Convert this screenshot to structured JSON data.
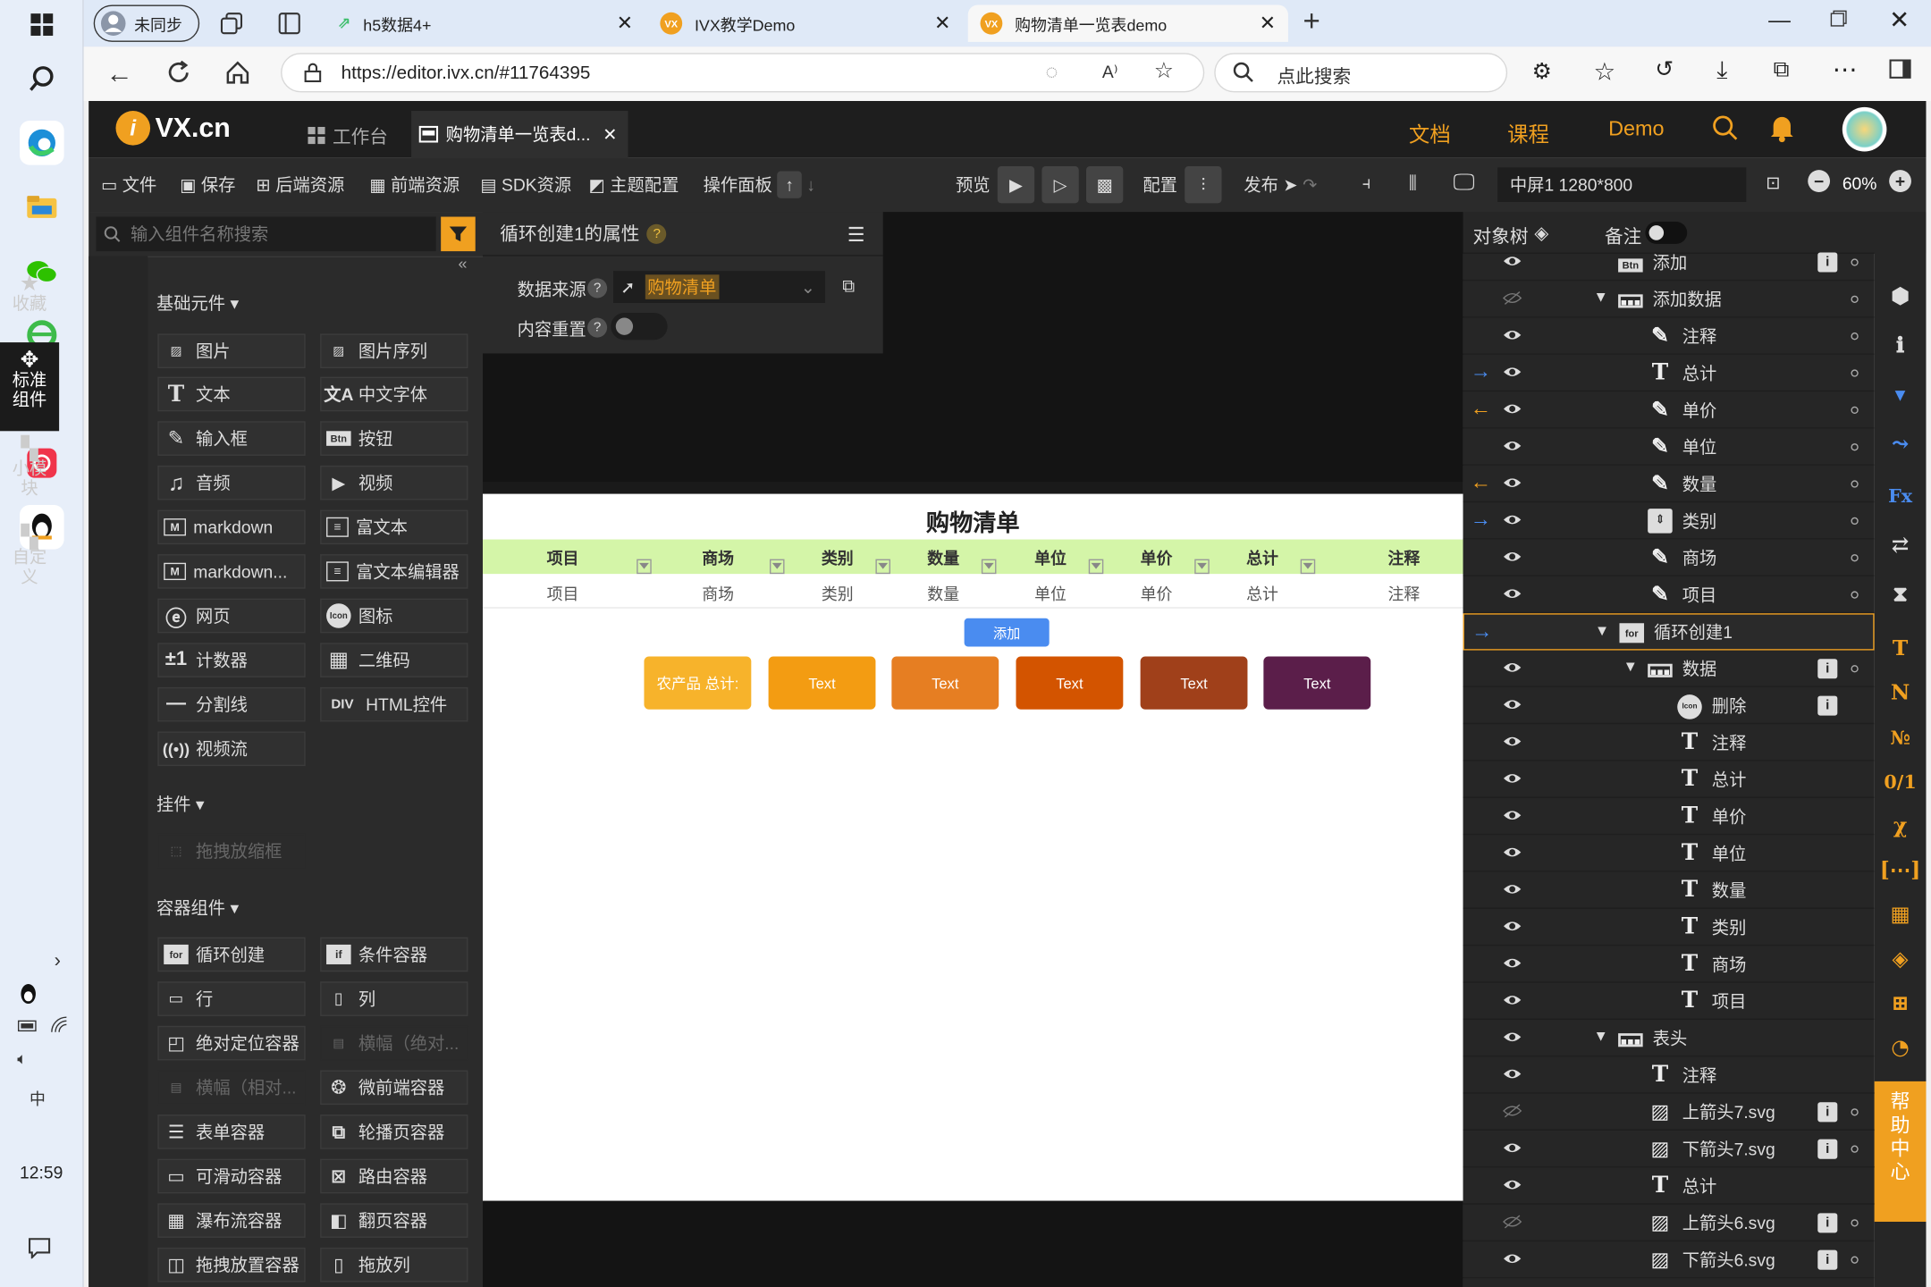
{
  "taskbar": {
    "time": "12:59"
  },
  "browser": {
    "profile_label": "未同步",
    "tabs": [
      {
        "label": "h5数据4+"
      },
      {
        "label": "IVX教学Demo"
      },
      {
        "label": "购物清单一览表demo"
      }
    ],
    "url": "https://editor.ivx.cn/#11764395",
    "search_placeholder": "点此搜索"
  },
  "app": {
    "logo_text": "VX.cn",
    "tabs": [
      {
        "label": "工作台"
      },
      {
        "label": "购物清单一览表d..."
      }
    ],
    "header_links": [
      "文档",
      "课程",
      "Demo"
    ],
    "toolbar": {
      "file": "文件",
      "save": "保存",
      "backend": "后端资源",
      "frontend": "前端资源",
      "sdk": "SDK资源",
      "theme": "主题配置",
      "ops": "操作面板",
      "preview": "预览",
      "config": "配置",
      "publish": "发布",
      "screen": "中屏1 1280*800",
      "zoom": "60%"
    },
    "left": {
      "search_placeholder": "输入组件名称搜索",
      "side_tabs": [
        "收藏",
        "标准组件",
        "小模块",
        "自定义"
      ],
      "sections": {
        "basic": "基础元件",
        "plugin": "挂件",
        "container": "容器组件"
      },
      "basic": [
        "图片",
        "图片序列",
        "文本",
        "中文字体",
        "输入框",
        "按钮",
        "音频",
        "视频",
        "markdown",
        "富文本",
        "markdown...",
        "富文本编辑器",
        "网页",
        "图标",
        "计数器",
        "二维码",
        "分割线",
        "HTML控件",
        "视频流"
      ],
      "plugin": [
        "拖拽放缩框"
      ],
      "container": [
        "循环创建",
        "条件容器",
        "行",
        "列",
        "绝对定位容器",
        "横幅（绝对...",
        "横幅（相对...",
        "微前端容器",
        "表单容器",
        "轮播页容器",
        "可滑动容器",
        "路由容器",
        "瀑布流容器",
        "翻页容器",
        "拖拽放置容器",
        "拖放列"
      ]
    },
    "props": {
      "title": "循环创建1的属性",
      "data_source_label": "数据来源",
      "data_source_value": "购物清单",
      "reset_label": "内容重置"
    },
    "canvas": {
      "page_title": "购物清单",
      "headers": [
        "项目",
        "商场",
        "类别",
        "数量",
        "单位",
        "单价",
        "总计",
        "注释"
      ],
      "row": [
        "项目",
        "商场",
        "类别",
        "数量",
        "单位",
        "单价",
        "总计",
        "注释"
      ],
      "add_button": "添加",
      "summary_label": "农产品 总计:",
      "cards": [
        "Text",
        "Text",
        "Text",
        "Text",
        "Text"
      ],
      "card_colors": [
        "#f39c12",
        "#e67e22",
        "#d35400",
        "#a0401a",
        "#5b1e4a"
      ]
    },
    "right": {
      "tab_tree": "对象树",
      "tab_notes": "备注",
      "tree": [
        {
          "label": "添加",
          "icon": "btn-icon"
        },
        {
          "label": "添加数据",
          "icon": "row-icon"
        },
        {
          "label": "注释",
          "icon": "input-icon"
        },
        {
          "label": "总计",
          "icon": "text-icon"
        },
        {
          "label": "单价",
          "icon": "input-icon"
        },
        {
          "label": "单位",
          "icon": "input-icon"
        },
        {
          "label": "数量",
          "icon": "input-icon"
        },
        {
          "label": "类别",
          "icon": "select-icon"
        },
        {
          "label": "商场",
          "icon": "input-icon"
        },
        {
          "label": "项目",
          "icon": "input-icon"
        },
        {
          "label": "循环创建1",
          "icon": "for-icon"
        },
        {
          "label": "数据",
          "icon": "row-icon"
        },
        {
          "label": "删除",
          "icon": "icon-icon"
        },
        {
          "label": "注释",
          "icon": "text-icon"
        },
        {
          "label": "总计",
          "icon": "text-icon"
        },
        {
          "label": "单价",
          "icon": "text-icon"
        },
        {
          "label": "单位",
          "icon": "text-icon"
        },
        {
          "label": "数量",
          "icon": "text-icon"
        },
        {
          "label": "类别",
          "icon": "text-icon"
        },
        {
          "label": "商场",
          "icon": "text-icon"
        },
        {
          "label": "项目",
          "icon": "text-icon"
        },
        {
          "label": "表头",
          "icon": "row-icon"
        },
        {
          "label": "注释",
          "icon": "text-icon"
        },
        {
          "label": "上箭头7.svg",
          "icon": "image-icon"
        },
        {
          "label": "下箭头7.svg",
          "icon": "image-icon"
        },
        {
          "label": "总计",
          "icon": "text-icon"
        },
        {
          "label": "上箭头6.svg",
          "icon": "image-icon"
        },
        {
          "label": "下箭头6.svg",
          "icon": "image-icon"
        }
      ],
      "help": "帮助中心"
    }
  },
  "colors": {
    "accent": "#f0a020",
    "blue": "#4a8cf0",
    "header_green": "#d4f5a8"
  }
}
